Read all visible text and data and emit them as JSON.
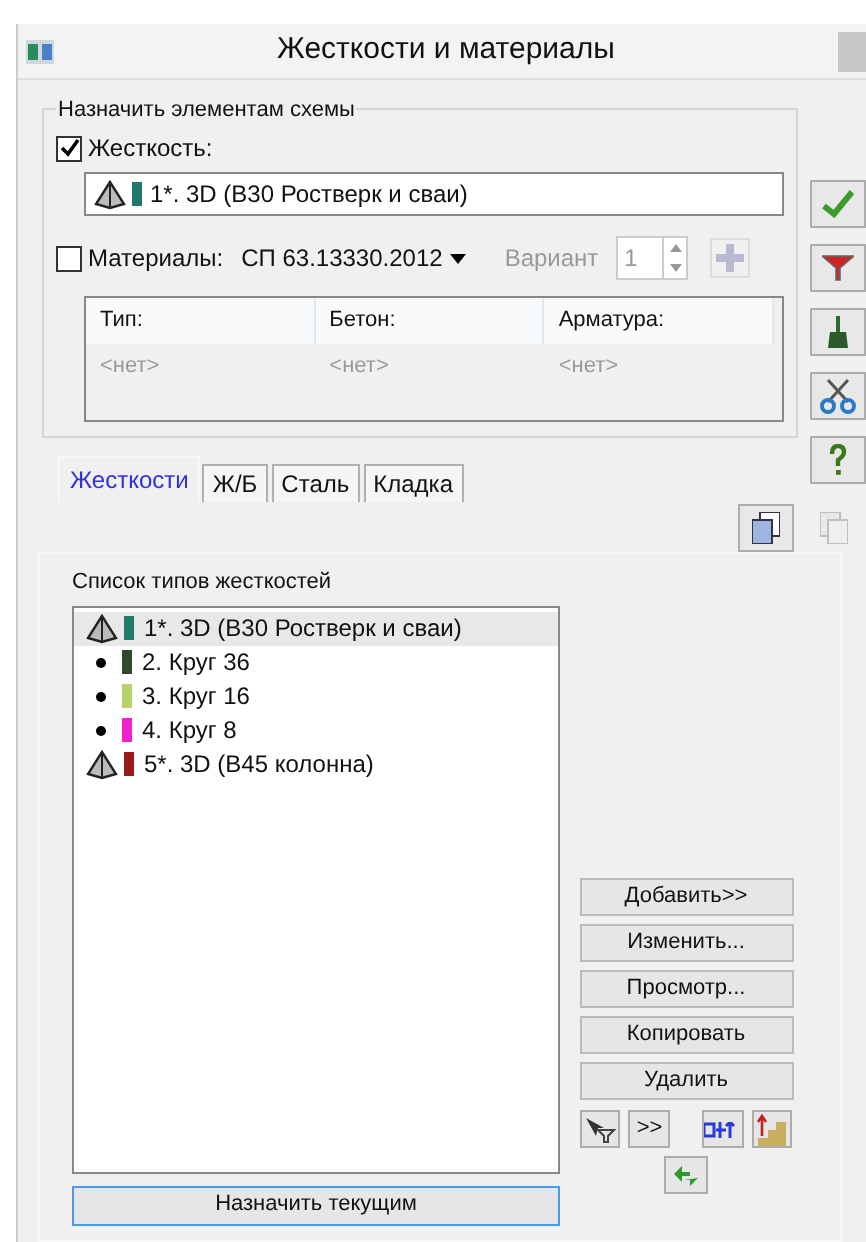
{
  "window": {
    "title": "Жесткости и материалы"
  },
  "assign_group": {
    "title": "Назначить элементам схемы",
    "stiffness": {
      "label": "Жесткость:",
      "checked": true,
      "value": {
        "kind": "pyramid",
        "color": "#1f7a6a",
        "text": "1*. 3D  (B30 Ростверк и сваи)"
      }
    },
    "materials": {
      "label": "Материалы:",
      "checked": false,
      "standard": "СП 63.13330.2012",
      "variant_label": "Вариант",
      "variant_value": "1"
    },
    "table": {
      "columns": [
        "Тип:",
        "Бетон:",
        "Арматура:"
      ],
      "values": [
        "<нет>",
        "<нет>",
        "<нет>"
      ]
    }
  },
  "tabs": [
    {
      "label": "Жесткости",
      "selected": true
    },
    {
      "label": "Ж/Б",
      "selected": false
    },
    {
      "label": "Сталь",
      "selected": false
    },
    {
      "label": "Кладка",
      "selected": false
    }
  ],
  "list": {
    "title": "Список типов жесткостей",
    "items": [
      {
        "kind": "pyramid",
        "color": "#1f7a6a",
        "text": "1*. 3D  (B30 Ростверк и сваи)",
        "selected": true
      },
      {
        "kind": "circle",
        "color": "#2f4a2a",
        "text": "2. Круг 36",
        "selected": false
      },
      {
        "kind": "circle",
        "color": "#b5d36a",
        "text": "3. Круг 16",
        "selected": false
      },
      {
        "kind": "circle",
        "color": "#f020d0",
        "text": "4. Круг 8",
        "selected": false
      },
      {
        "kind": "pyramid",
        "color": "#9a1a1a",
        "text": "5*. 3D  (B45 колонна)",
        "selected": false
      }
    ]
  },
  "actions": [
    "Добавить>>",
    "Изменить...",
    "Просмотр...",
    "Копировать",
    "Удалить"
  ],
  "arrow_button": ">>",
  "assign_current": "Назначить текущим"
}
